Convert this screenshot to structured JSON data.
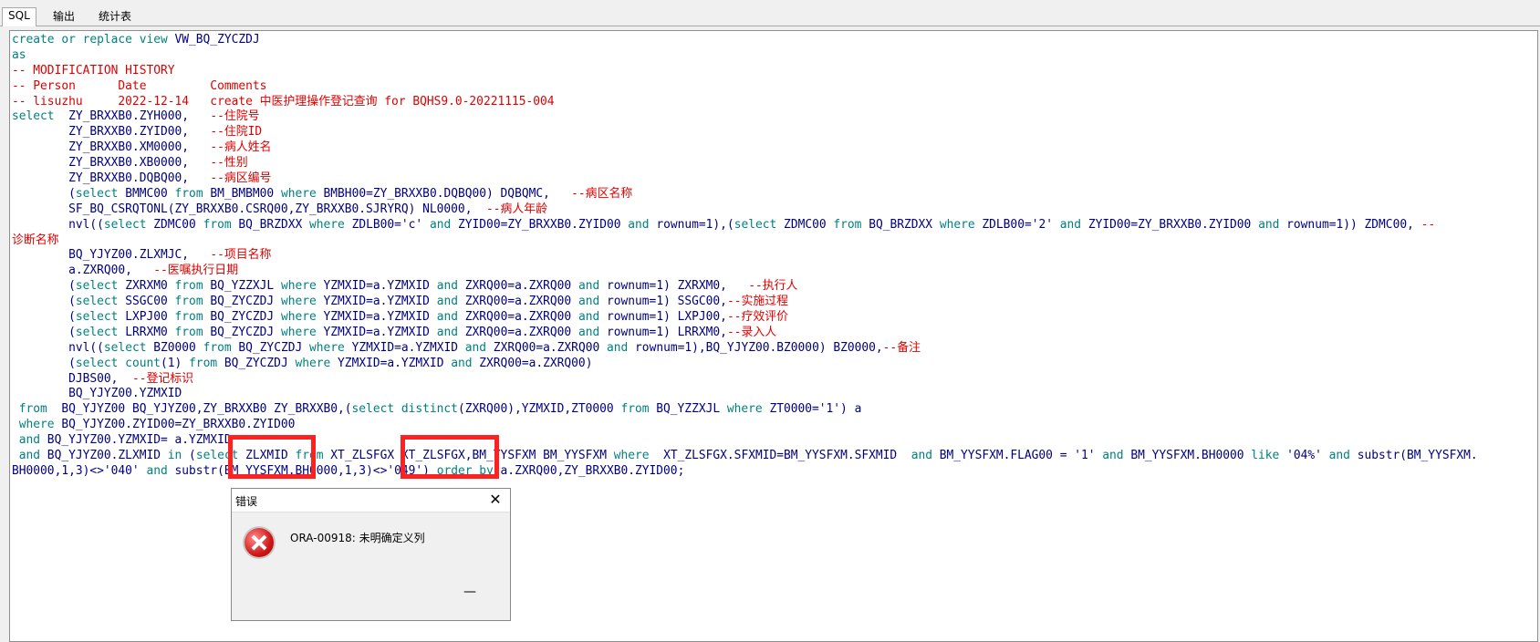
{
  "tabs": [
    {
      "label": "SQL",
      "active": true
    },
    {
      "label": "输出",
      "active": false
    },
    {
      "label": "统计表",
      "active": false
    }
  ],
  "code_lines": [
    [
      {
        "t": "create or replace view",
        "c": "kw"
      },
      {
        "t": " VW_BQ_ZYCZDJ",
        "c": "plain"
      }
    ],
    [
      {
        "t": "as",
        "c": "kw"
      }
    ],
    [
      {
        "t": "-- MODIFICATION HISTORY",
        "c": "cm"
      }
    ],
    [
      {
        "t": "-- Person      Date         Comments",
        "c": "cm"
      }
    ],
    [
      {
        "t": "-- lisuzhu     2022-12-14   create 中医护理操作登记查询 for BQHS9.0-20221115-004",
        "c": "cm"
      }
    ],
    [
      {
        "t": "select",
        "c": "kw"
      },
      {
        "t": "  ZY_BRXXB0.ZYH000,   ",
        "c": "plain"
      },
      {
        "t": "--住院号",
        "c": "cm"
      }
    ],
    [
      {
        "t": "        ZY_BRXXB0.ZYID00,   ",
        "c": "plain"
      },
      {
        "t": "--住院ID",
        "c": "cm"
      }
    ],
    [
      {
        "t": "        ZY_BRXXB0.XM0000,   ",
        "c": "plain"
      },
      {
        "t": "--病人姓名",
        "c": "cm"
      }
    ],
    [
      {
        "t": "        ZY_BRXXB0.XB0000,   ",
        "c": "plain"
      },
      {
        "t": "--性别",
        "c": "cm"
      }
    ],
    [
      {
        "t": "        ZY_BRXXB0.DQBQ00,   ",
        "c": "plain"
      },
      {
        "t": "--病区编号",
        "c": "cm"
      }
    ],
    [
      {
        "t": "        (",
        "c": "plain"
      },
      {
        "t": "select",
        "c": "kw"
      },
      {
        "t": " BMMC00 ",
        "c": "plain"
      },
      {
        "t": "from",
        "c": "kw"
      },
      {
        "t": " BM_BMBM00 ",
        "c": "plain"
      },
      {
        "t": "where",
        "c": "kw"
      },
      {
        "t": " BMBH00=ZY_BRXXB0.DQBQ00) DQBQMC,   ",
        "c": "plain"
      },
      {
        "t": "--病区名称",
        "c": "cm"
      }
    ],
    [
      {
        "t": "        SF_BQ_CSRQTONL(ZY_BRXXB0.CSRQ00,ZY_BRXXB0.SJRYRQ) NL0000,  ",
        "c": "plain"
      },
      {
        "t": "--病人年龄",
        "c": "cm"
      }
    ],
    [
      {
        "t": "        nvl((",
        "c": "plain"
      },
      {
        "t": "select",
        "c": "kw"
      },
      {
        "t": " ZDMC00 ",
        "c": "plain"
      },
      {
        "t": "from",
        "c": "kw"
      },
      {
        "t": " BQ_BRZDXX ",
        "c": "plain"
      },
      {
        "t": "where",
        "c": "kw"
      },
      {
        "t": " ZDLB00='c' ",
        "c": "plain"
      },
      {
        "t": "and",
        "c": "kw"
      },
      {
        "t": " ZYID00=ZY_BRXXB0.ZYID00 ",
        "c": "plain"
      },
      {
        "t": "and",
        "c": "kw"
      },
      {
        "t": " rownum=1),(",
        "c": "plain"
      },
      {
        "t": "select",
        "c": "kw"
      },
      {
        "t": " ZDMC00 ",
        "c": "plain"
      },
      {
        "t": "from",
        "c": "kw"
      },
      {
        "t": " BQ_BRZDXX ",
        "c": "plain"
      },
      {
        "t": "where",
        "c": "kw"
      },
      {
        "t": " ZDLB00='2' ",
        "c": "plain"
      },
      {
        "t": "and",
        "c": "kw"
      },
      {
        "t": " ZYID00=ZY_BRXXB0.ZYID00 ",
        "c": "plain"
      },
      {
        "t": "and",
        "c": "kw"
      },
      {
        "t": " rownum=1)) ZDMC00, ",
        "c": "plain"
      },
      {
        "t": "--",
        "c": "cm"
      }
    ],
    [
      {
        "t": "诊断名称",
        "c": "cm"
      }
    ],
    [
      {
        "t": "        BQ_YJYZ00.ZLXMJC,   ",
        "c": "plain"
      },
      {
        "t": "--项目名称",
        "c": "cm"
      }
    ],
    [
      {
        "t": "        a.ZXRQ00,   ",
        "c": "plain"
      },
      {
        "t": "--医嘱执行日期",
        "c": "cm"
      }
    ],
    [
      {
        "t": "        (",
        "c": "plain"
      },
      {
        "t": "select",
        "c": "kw"
      },
      {
        "t": " ZXRXM0 ",
        "c": "plain"
      },
      {
        "t": "from",
        "c": "kw"
      },
      {
        "t": " BQ_YZZXJL ",
        "c": "plain"
      },
      {
        "t": "where",
        "c": "kw"
      },
      {
        "t": " YZMXID=a.YZMXID ",
        "c": "plain"
      },
      {
        "t": "and",
        "c": "kw"
      },
      {
        "t": " ZXRQ00=a.ZXRQ00 ",
        "c": "plain"
      },
      {
        "t": "and",
        "c": "kw"
      },
      {
        "t": " rownum=1) ZXRXM0,   ",
        "c": "plain"
      },
      {
        "t": "--执行人",
        "c": "cm"
      }
    ],
    [
      {
        "t": "        (",
        "c": "plain"
      },
      {
        "t": "select",
        "c": "kw"
      },
      {
        "t": " SSGC00 ",
        "c": "plain"
      },
      {
        "t": "from",
        "c": "kw"
      },
      {
        "t": " BQ_ZYCZDJ ",
        "c": "plain"
      },
      {
        "t": "where",
        "c": "kw"
      },
      {
        "t": " YZMXID=a.YZMXID ",
        "c": "plain"
      },
      {
        "t": "and",
        "c": "kw"
      },
      {
        "t": " ZXRQ00=a.ZXRQ00 ",
        "c": "plain"
      },
      {
        "t": "and",
        "c": "kw"
      },
      {
        "t": " rownum=1) SSGC00,",
        "c": "plain"
      },
      {
        "t": "--实施过程",
        "c": "cm"
      }
    ],
    [
      {
        "t": "        (",
        "c": "plain"
      },
      {
        "t": "select",
        "c": "kw"
      },
      {
        "t": " LXPJ00 ",
        "c": "plain"
      },
      {
        "t": "from",
        "c": "kw"
      },
      {
        "t": " BQ_ZYCZDJ ",
        "c": "plain"
      },
      {
        "t": "where",
        "c": "kw"
      },
      {
        "t": " YZMXID=a.YZMXID ",
        "c": "plain"
      },
      {
        "t": "and",
        "c": "kw"
      },
      {
        "t": " ZXRQ00=a.ZXRQ00 ",
        "c": "plain"
      },
      {
        "t": "and",
        "c": "kw"
      },
      {
        "t": " rownum=1) LXPJ00,",
        "c": "plain"
      },
      {
        "t": "--疗效评价",
        "c": "cm"
      }
    ],
    [
      {
        "t": "        (",
        "c": "plain"
      },
      {
        "t": "select",
        "c": "kw"
      },
      {
        "t": " LRRXM0 ",
        "c": "plain"
      },
      {
        "t": "from",
        "c": "kw"
      },
      {
        "t": " BQ_ZYCZDJ ",
        "c": "plain"
      },
      {
        "t": "where",
        "c": "kw"
      },
      {
        "t": " YZMXID=a.YZMXID ",
        "c": "plain"
      },
      {
        "t": "and",
        "c": "kw"
      },
      {
        "t": " ZXRQ00=a.ZXRQ00 ",
        "c": "plain"
      },
      {
        "t": "and",
        "c": "kw"
      },
      {
        "t": " rownum=1) LRRXM0,",
        "c": "plain"
      },
      {
        "t": "--录入人",
        "c": "cm"
      }
    ],
    [
      {
        "t": "        nvl((",
        "c": "plain"
      },
      {
        "t": "select",
        "c": "kw"
      },
      {
        "t": " BZ0000 ",
        "c": "plain"
      },
      {
        "t": "from",
        "c": "kw"
      },
      {
        "t": " BQ_ZYCZDJ ",
        "c": "plain"
      },
      {
        "t": "where",
        "c": "kw"
      },
      {
        "t": " YZMXID=a.YZMXID ",
        "c": "plain"
      },
      {
        "t": "and",
        "c": "kw"
      },
      {
        "t": " ZXRQ00=a.ZXRQ00 ",
        "c": "plain"
      },
      {
        "t": "and",
        "c": "kw"
      },
      {
        "t": " rownum=1),BQ_YJYZ00.BZ0000) BZ0000,",
        "c": "plain"
      },
      {
        "t": "--备注",
        "c": "cm"
      }
    ],
    [
      {
        "t": "        (",
        "c": "plain"
      },
      {
        "t": "select count",
        "c": "kw"
      },
      {
        "t": "(1) ",
        "c": "plain"
      },
      {
        "t": "from",
        "c": "kw"
      },
      {
        "t": " BQ_ZYCZDJ ",
        "c": "plain"
      },
      {
        "t": "where",
        "c": "kw"
      },
      {
        "t": " YZMXID=a.YZMXID ",
        "c": "plain"
      },
      {
        "t": "and",
        "c": "kw"
      },
      {
        "t": " ZXRQ00=a.ZXRQ00)",
        "c": "plain"
      }
    ],
    [
      {
        "t": "        DJBS00,  ",
        "c": "plain"
      },
      {
        "t": "--登记标识",
        "c": "cm"
      }
    ],
    [
      {
        "t": "        BQ_YJYZ00.YZMXID",
        "c": "plain"
      }
    ],
    [
      {
        "t": " from",
        "c": "kw"
      },
      {
        "t": "  BQ_YJYZ00 BQ_YJYZ00,ZY_BRXXB0 ZY_BRXXB0,(",
        "c": "plain"
      },
      {
        "t": "select distinct",
        "c": "kw"
      },
      {
        "t": "(ZXRQ00),YZMXID,ZT0000 ",
        "c": "plain"
      },
      {
        "t": "from",
        "c": "kw"
      },
      {
        "t": " BQ_YZZXJL ",
        "c": "plain"
      },
      {
        "t": "where",
        "c": "kw"
      },
      {
        "t": " ZT0000='1') a",
        "c": "plain"
      }
    ],
    [
      {
        "t": " where",
        "c": "kw"
      },
      {
        "t": " BQ_YJYZ00.ZYID00=ZY_BRXXB0.ZYID00",
        "c": "plain"
      }
    ],
    [
      {
        "t": " and",
        "c": "kw"
      },
      {
        "t": " BQ_YJYZ00.YZMXID= a.YZMXID",
        "c": "plain"
      }
    ],
    [
      {
        "t": " and",
        "c": "kw"
      },
      {
        "t": " BQ_YJYZ00.ZLXMID ",
        "c": "plain"
      },
      {
        "t": "in",
        "c": "kw"
      },
      {
        "t": " (",
        "c": "plain"
      },
      {
        "t": "select",
        "c": "kw"
      },
      {
        "t": " ZLXMID ",
        "c": "plain"
      },
      {
        "t": "from",
        "c": "kw"
      },
      {
        "t": " XT_ZLSFGX XT_ZLSFGX,BM_YYSFXM BM_YYSFXM ",
        "c": "plain"
      },
      {
        "t": "where",
        "c": "kw"
      },
      {
        "t": "  XT_ZLSFGX.SFXMID=BM_YYSFXM.SFXMID  ",
        "c": "plain"
      },
      {
        "t": "and",
        "c": "kw"
      },
      {
        "t": " BM_YYSFXM.FLAG00 = '1' ",
        "c": "plain"
      },
      {
        "t": "and",
        "c": "kw"
      },
      {
        "t": " BM_YYSFXM.BH0000 ",
        "c": "plain"
      },
      {
        "t": "like",
        "c": "kw"
      },
      {
        "t": " '04%' ",
        "c": "plain"
      },
      {
        "t": "and",
        "c": "kw"
      },
      {
        "t": " substr(BM_YYSFXM.",
        "c": "plain"
      }
    ],
    [
      {
        "t": "BH0000,1,3)<>'040' ",
        "c": "plain"
      },
      {
        "t": "and",
        "c": "kw"
      },
      {
        "t": " substr(BM_YYSFXM.BH0000,1,3)<>'049') ",
        "c": "plain"
      },
      {
        "t": "order by",
        "c": "kw"
      },
      {
        "t": " a.ZXRQ00,ZY_BRXXB0.ZYID00;",
        "c": "plain"
      }
    ]
  ],
  "error_dialog": {
    "title": "错误",
    "close_glyph": "✕",
    "icon": "error-icon",
    "message": "ORA-00918: 未明确定义列",
    "cursor_glyph": "—"
  },
  "colors": {
    "keyword": "#008080",
    "comment": "#e00000",
    "identifier": "#000080",
    "highlight_box": "#ff2020"
  }
}
